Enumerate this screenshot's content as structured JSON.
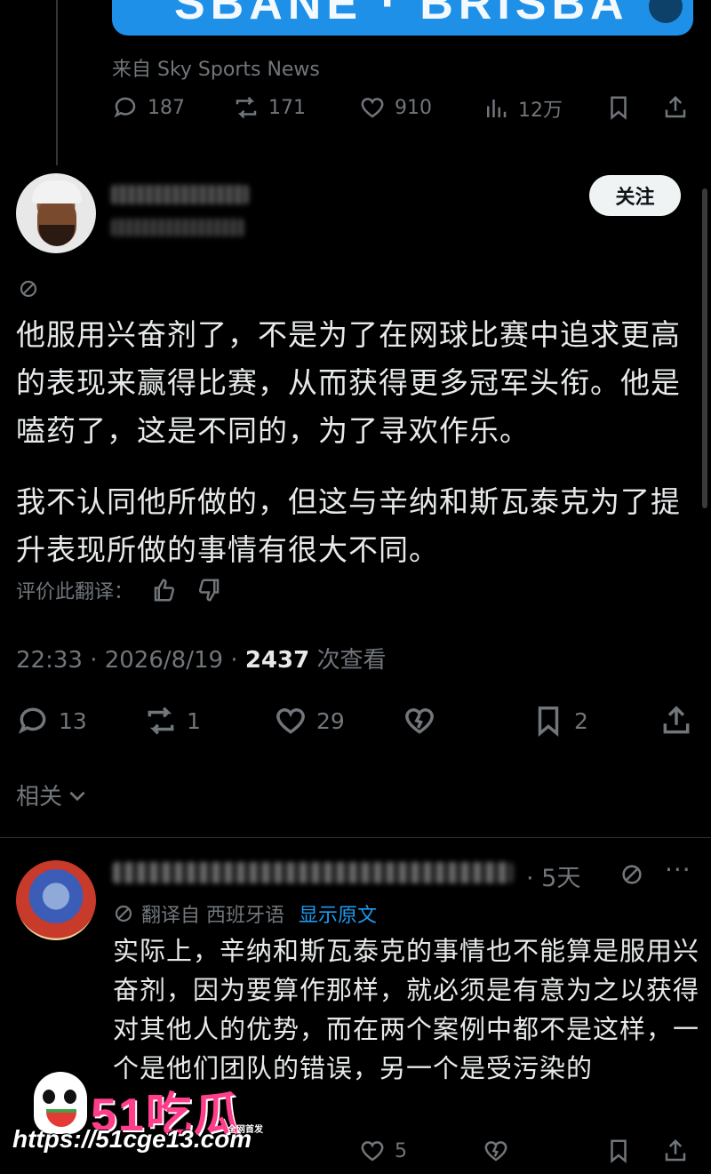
{
  "quoted": {
    "media_text": "SBANE · BRISBA",
    "source": "来自 Sky Sports News",
    "actions": {
      "replies": "187",
      "reposts": "171",
      "likes": "910",
      "views": "12万"
    }
  },
  "tweet": {
    "follow_label": "关注",
    "paragraph1": "他服用兴奋剂了，不是为了在网球比赛中追求更高的表现来赢得比赛，从而获得更多冠军头衔。他是嗑药了，这是不同的，为了寻欢作乐。",
    "paragraph2": "我不认同他所做的，但这与辛纳和斯瓦泰克为了提升表现所做的事情有很大不同。",
    "rate_label": "评价此翻译：",
    "time": "22:33 · 2026/8/19 · ",
    "views_count": "2437",
    "views_label": " 次查看",
    "actions": {
      "replies": "13",
      "reposts": "1",
      "likes": "29",
      "bookmarks": "2"
    },
    "related_label": "相关"
  },
  "reply": {
    "time": "· 5天",
    "more": "···",
    "translated_label": "翻译自 西班牙语",
    "show_original": "显示原文",
    "text": "实际上，辛纳和斯瓦泰克的事情也不能算是服用兴奋剂，因为要算作那样，就必须是有意为之以获得对其他人的优势，而在两个案例中都不是这样，一个是他们团队的错误，另一个是受污染的",
    "actions": {
      "likes": "5"
    }
  },
  "watermark": {
    "logo": "51吃瓜",
    "tag": "全网首发",
    "url": "https://51cge13.com"
  }
}
